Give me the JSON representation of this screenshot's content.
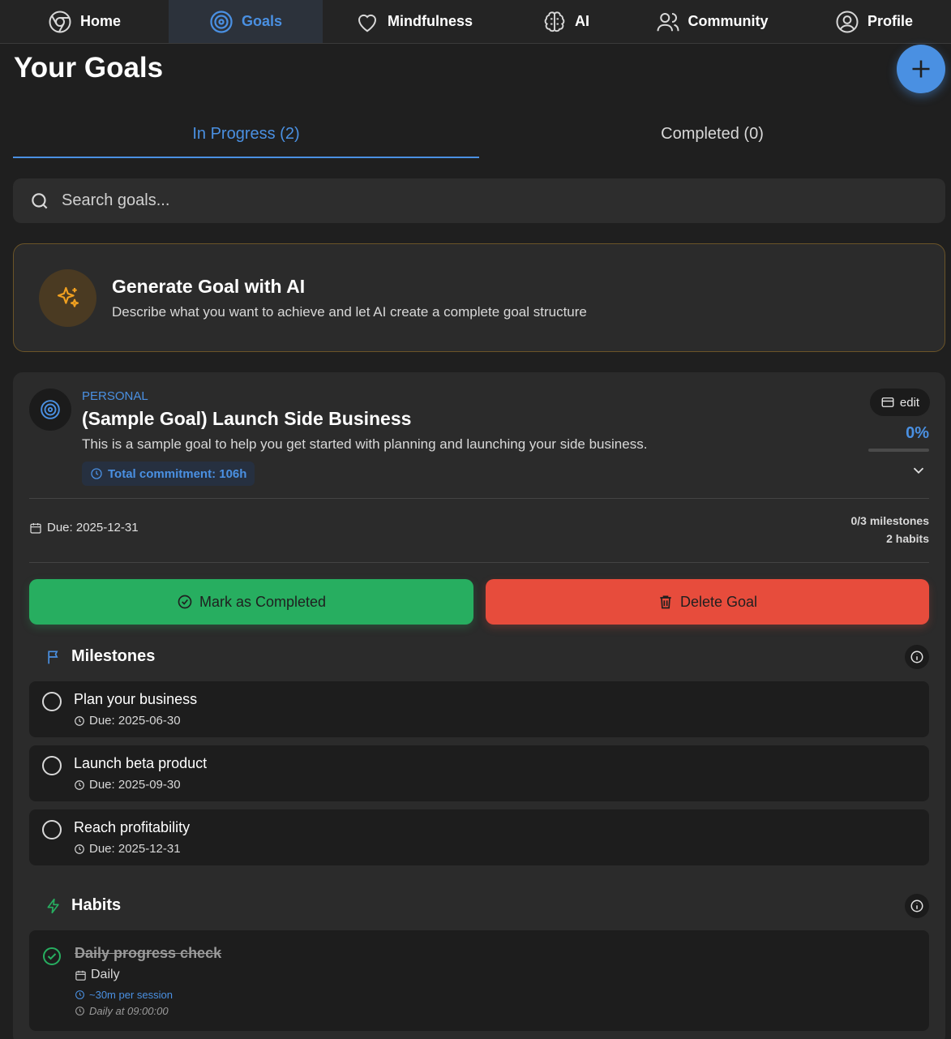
{
  "nav": {
    "items": [
      {
        "label": "Home",
        "icon": "chrome-icon"
      },
      {
        "label": "Goals",
        "icon": "target-icon",
        "active": true
      },
      {
        "label": "Mindfulness",
        "icon": "heart-icon"
      },
      {
        "label": "AI",
        "icon": "brain-icon"
      },
      {
        "label": "Community",
        "icon": "users-icon"
      },
      {
        "label": "Profile",
        "icon": "user-circle-icon"
      }
    ]
  },
  "page": {
    "title": "Your Goals"
  },
  "tabs": {
    "in_progress": "In Progress (2)",
    "completed": "Completed (0)"
  },
  "search": {
    "placeholder": "Search goals..."
  },
  "ai_card": {
    "title": "Generate Goal with AI",
    "description": "Describe what you want to achieve and let AI create a complete goal structure"
  },
  "goal": {
    "category": "PERSONAL",
    "title": "(Sample Goal) Launch Side Business",
    "description": "This is a sample goal to help you get started with planning and launching your side business.",
    "commitment": "Total commitment: 106h",
    "edit_label": "edit",
    "progress_label": "0%",
    "progress": 0,
    "due": "Due: 2025-12-31",
    "milestones_count": "0/3 milestones",
    "habits_count": "2 habits",
    "complete_label": "Mark as Completed",
    "delete_label": "Delete Goal",
    "milestones_heading": "Milestones",
    "milestones": [
      {
        "title": "Plan your business",
        "due": "Due: 2025-06-30"
      },
      {
        "title": "Launch beta product",
        "due": "Due: 2025-09-30"
      },
      {
        "title": "Reach profitability",
        "due": "Due: 2025-12-31"
      }
    ],
    "habits_heading": "Habits",
    "habits": [
      {
        "title": "Daily progress check",
        "frequency": "Daily",
        "session": "~30m per session",
        "schedule": "Daily at 09:00:00"
      }
    ]
  },
  "colors": {
    "accent": "#4a90e2",
    "success": "#27ae60",
    "danger": "#e74c3c",
    "warning": "#f0a020"
  }
}
